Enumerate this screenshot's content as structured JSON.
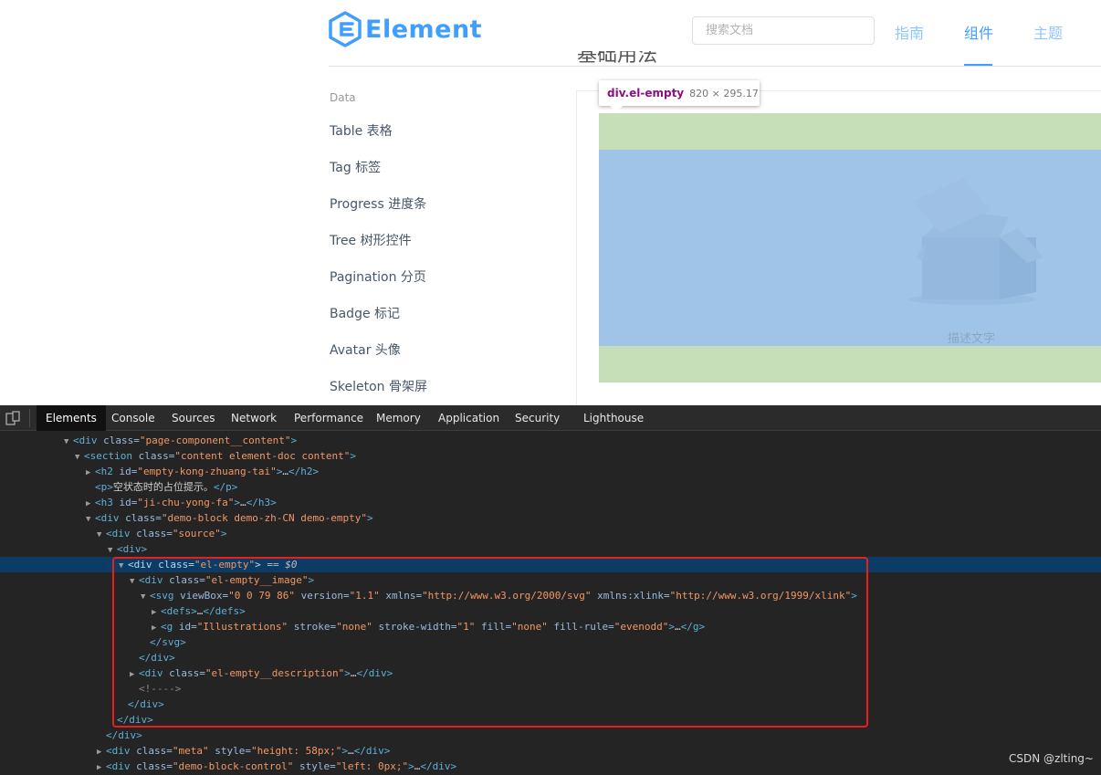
{
  "header": {
    "logo_text": "Element",
    "search_placeholder": "搜索文档",
    "nav": [
      "指南",
      "组件",
      "主题"
    ]
  },
  "section_heading_partial": "基础用法",
  "sidebar": {
    "group": "Data",
    "items": [
      "Table 表格",
      "Tag 标签",
      "Progress 进度条",
      "Tree 树形控件",
      "Pagination 分页",
      "Badge 标记",
      "Avatar 头像",
      "Skeleton 骨架屏"
    ]
  },
  "demo": {
    "tooltip_tag": "div.el-empty",
    "tooltip_dims": "820 × 295.17",
    "empty_description": "描述文字"
  },
  "devtools": {
    "tabs": [
      "Elements",
      "Console",
      "Sources",
      "Network",
      "Performance",
      "Memory",
      "Application",
      "Security",
      "Lighthouse"
    ],
    "active_tab": "Elements"
  },
  "watermark": "CSDN @zlting~",
  "colors": {
    "accent": "#409eff",
    "highlight_margin": "#c6dfb8",
    "highlight_content": "#a0c4e8",
    "selection_box": "#e8201b"
  }
}
